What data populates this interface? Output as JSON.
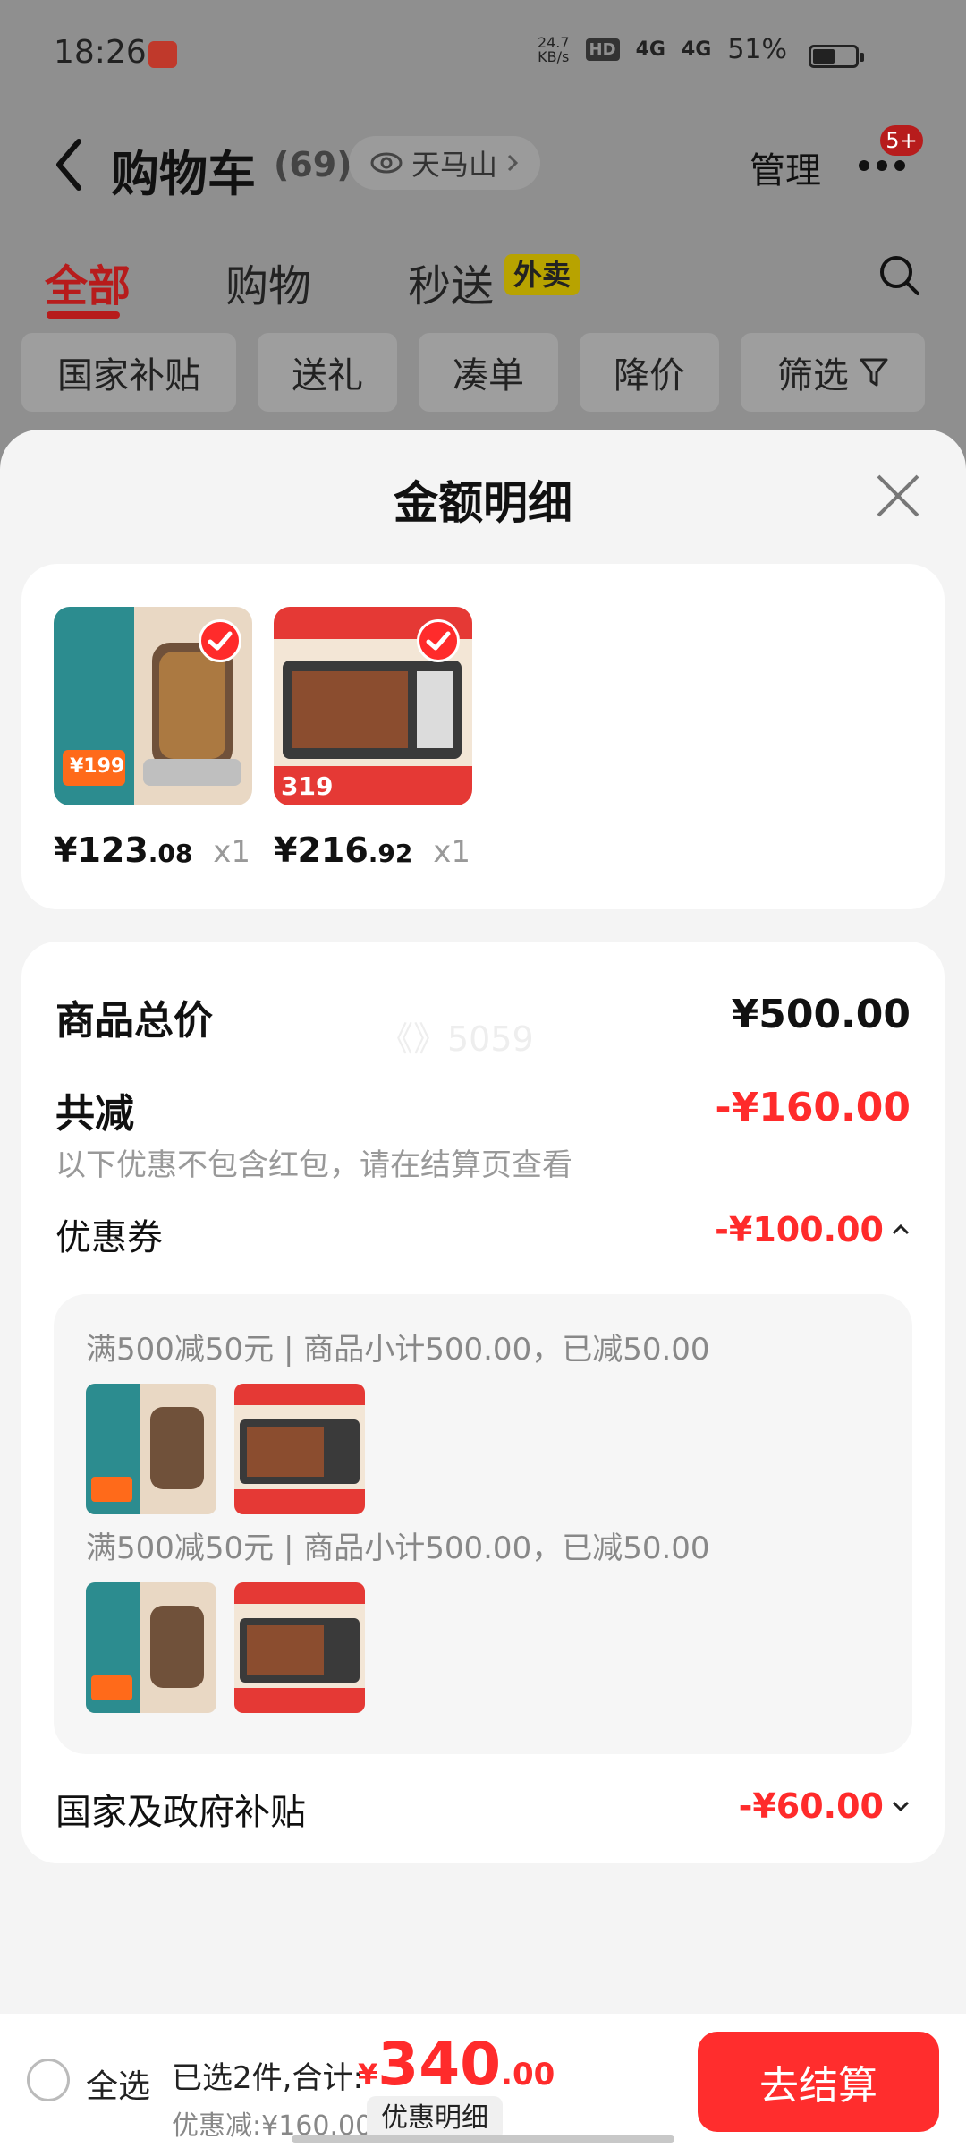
{
  "status_bar": {
    "time": "18:26",
    "net_speed_top": "24.7",
    "net_speed_bottom": "KB/s",
    "hd_badge": "HD",
    "signal_1": "4G",
    "signal_2": "4G",
    "battery": "51%"
  },
  "header": {
    "title": "购物车",
    "count": "(69)",
    "location": "天马山",
    "manage": "管理",
    "badge": "5+"
  },
  "tabs": [
    {
      "label": "全部"
    },
    {
      "label": "购物"
    },
    {
      "label": "秒送"
    }
  ],
  "waimai_tag": "外卖",
  "filters": [
    {
      "label": "国家补贴"
    },
    {
      "label": "送礼"
    },
    {
      "label": "凑单"
    },
    {
      "label": "降价"
    },
    {
      "label": "筛选"
    }
  ],
  "sheet": {
    "title": "金额明细",
    "products": [
      {
        "price_int": "¥123",
        "price_dec": ".08",
        "qty": "x1",
        "thumb_label": "¥199"
      },
      {
        "price_int": "¥216",
        "price_dec": ".92",
        "qty": "x1",
        "thumb_label": "319"
      }
    ],
    "total_label": "商品总价",
    "total_value": "¥500.00",
    "reduce_label": "共减",
    "reduce_value": "-¥160.00",
    "hint": "以下优惠不包含红包，请在结算页查看",
    "watermark": "《》5059",
    "coupon_label": "优惠券",
    "coupon_value": "-¥100.00",
    "coupon_lines": [
      "满500减50元 | 商品小计500.00，已减50.00",
      "满500减50元 | 商品小计500.00，已减50.00"
    ],
    "subsidy_label": "国家及政府补贴",
    "subsidy_value": "-¥60.00"
  },
  "bottom_bar": {
    "select_all": "全选",
    "summary": "已选2件,合计:",
    "price_yen": "¥",
    "price_int": "340",
    "price_dec": ".00",
    "discount": "优惠减:¥160.00",
    "detail_button": "优惠明细",
    "checkout": "去结算"
  },
  "colors": {
    "accent_red": "#ff2b2b",
    "dim_overlay": "#8f8f8f"
  }
}
